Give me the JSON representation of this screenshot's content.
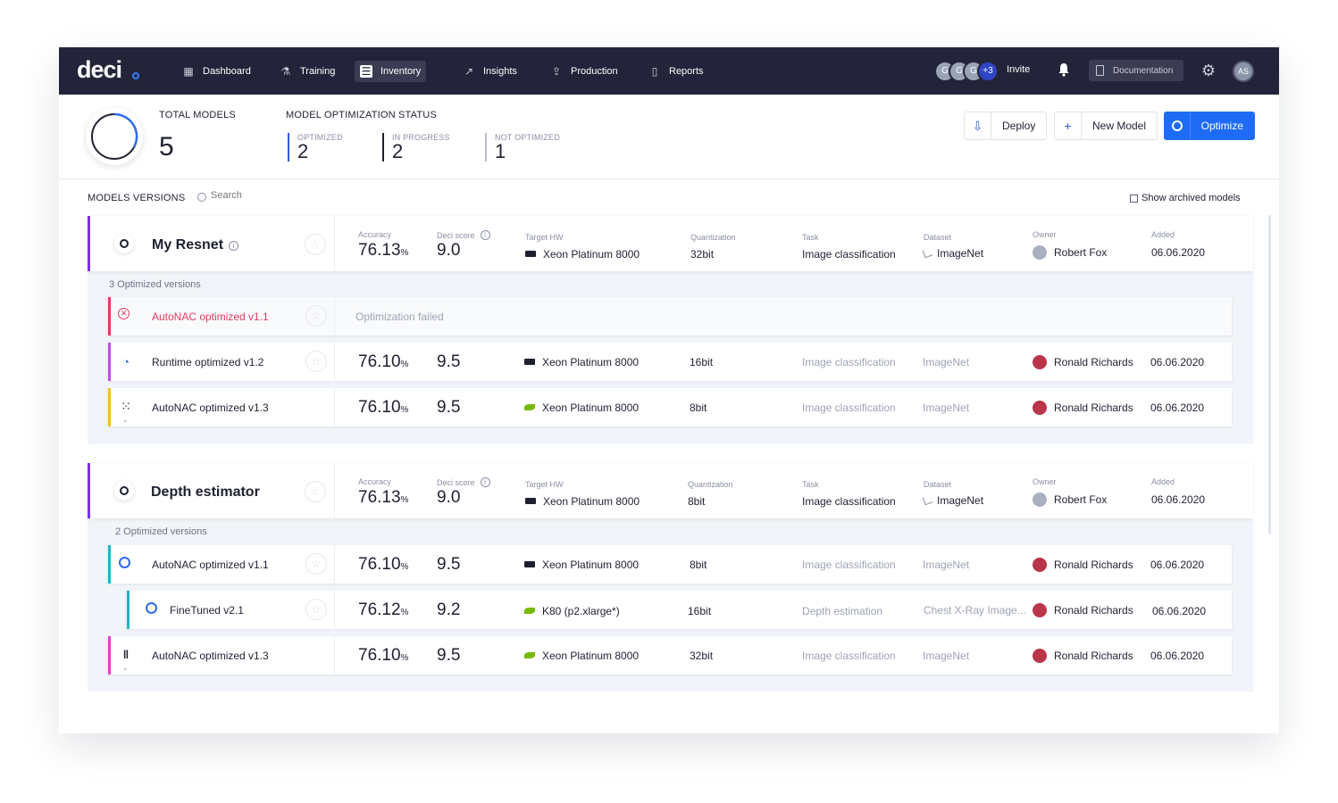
{
  "nav": {
    "logo": "deci",
    "items": [
      {
        "label": "Dashboard",
        "icon": "dashboard-icon"
      },
      {
        "label": "Training",
        "icon": "flask-icon"
      },
      {
        "label": "Inventory",
        "icon": "inventory-icon",
        "active": true
      },
      {
        "label": "Insights",
        "icon": "chart-line-icon"
      },
      {
        "label": "Production",
        "icon": "upload-icon"
      },
      {
        "label": "Reports",
        "icon": "document-icon"
      }
    ],
    "team_avatars": [
      "G",
      "G",
      "G"
    ],
    "team_more": "+3",
    "invite": "Invite",
    "documentation": "Documentation",
    "user_initials": "AS"
  },
  "summary": {
    "total_models_label": "TOTAL MODELS",
    "total_models": "5",
    "status_label": "MODEL OPTIMIZATION STATUS",
    "optimized_label": "OPTIMIZED",
    "optimized": "2",
    "in_progress_label": "IN PROGRESS",
    "in_progress": "2",
    "not_optimized_label": "NOT OPTIMIZED",
    "not_optimized": "1"
  },
  "actions": {
    "deploy": "Deploy",
    "new_model": "New Model",
    "optimize": "Optimize"
  },
  "list": {
    "title": "MODELS VERSIONS",
    "search_placeholder": "Search",
    "show_archived": "Show archived models"
  },
  "labels": {
    "accuracy": "Accuracy",
    "deci_score": "Deci score",
    "target_hw": "Target HW",
    "quantization": "Quantization",
    "task": "Task",
    "dataset": "Dataset",
    "owner": "Owner",
    "added": "Added",
    "percent": "%"
  },
  "models": [
    {
      "name": "My Resnet",
      "accuracy": "76.13",
      "score": "9.0",
      "hw": "Xeon Platinum 8000",
      "quantization": "32bit",
      "task": "Image classification",
      "dataset": "ImageNet",
      "owner": "Robert Fox",
      "added": "06.06.2020",
      "versions_count": "3 Optimized versions",
      "versions": [
        {
          "name": "AutoNAC optimized v1.1",
          "failed_text": "Optimization failed",
          "color": "#e23a63"
        },
        {
          "name": "Runtime optimized v1.2",
          "accuracy": "76.10",
          "score": "9.5",
          "hw": "Xeon Platinum 8000",
          "quantization": "16bit",
          "task": "Image classification",
          "dataset": "ImageNet",
          "owner": "Ronald Richards",
          "added": "06.06.2020",
          "color": "#c14fe6"
        },
        {
          "name": "AutoNAC optimized v1.3",
          "accuracy": "76.10",
          "score": "9.5",
          "hw": "Xeon Platinum 8000",
          "quantization": "8bit",
          "task": "Image classification",
          "dataset": "ImageNet",
          "owner": "Ronald Richards",
          "added": "06.06.2020",
          "color": "#f4c21c"
        }
      ]
    },
    {
      "name": "Depth estimator",
      "accuracy": "76.13",
      "score": "9.0",
      "hw": "Xeon Platinum 8000",
      "quantization": "8bit",
      "task": "Image classification",
      "dataset": "ImageNet",
      "owner": "Robert Fox",
      "added": "06.06.2020",
      "versions_count": "2 Optimized versions",
      "versions": [
        {
          "name": "AutoNAC optimized v1.1",
          "accuracy": "76.10",
          "score": "9.5",
          "hw": "Xeon Platinum 8000",
          "quantization": "8bit",
          "task": "Image classification",
          "dataset": "ImageNet",
          "owner": "Ronald Richards",
          "added": "06.06.2020",
          "color": "#1fb5c4"
        },
        {
          "name": "FineTuned v2.1",
          "accuracy": "76.12",
          "score": "9.2",
          "hw": "K80 (p2.xlarge*)",
          "quantization": "16bit",
          "task": "Depth estimation",
          "dataset": "Chest X-Ray Image...",
          "owner": "Ronald Richards",
          "added": "06.06.2020",
          "color": "#1fb5c4"
        },
        {
          "name": "AutoNAC optimized v1.3",
          "accuracy": "76.10",
          "score": "9.5",
          "hw": "Xeon Platinum 8000",
          "quantization": "32bit",
          "task": "Image classification",
          "dataset": "ImageNet",
          "owner": "Ronald Richards",
          "added": "06.06.2020",
          "color": "#e640c8"
        }
      ]
    }
  ],
  "colors": {
    "primary": "#1e6cf5",
    "nav_bg": "#23243a",
    "model_accent": "#7b2ff0",
    "failed": "#e23a63"
  }
}
